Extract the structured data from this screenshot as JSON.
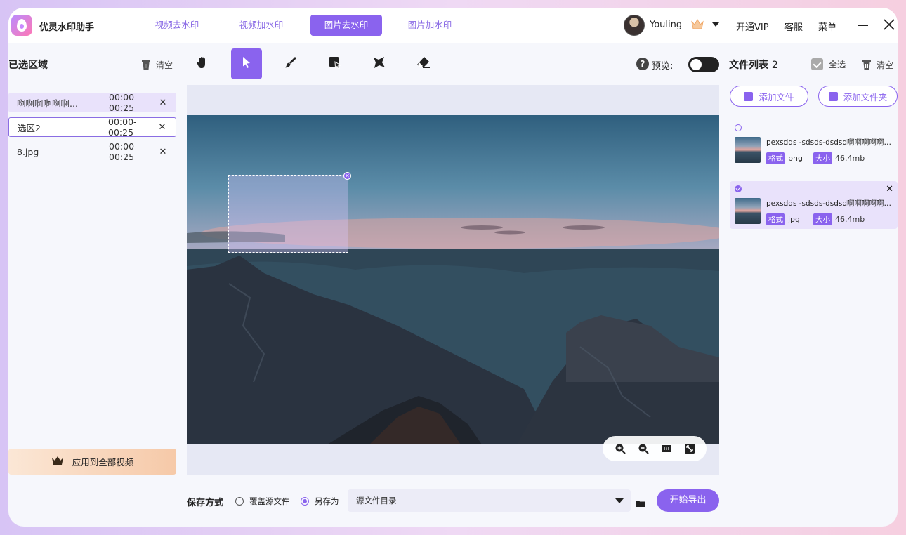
{
  "app": {
    "name": "优灵水印助手",
    "tabs": [
      {
        "label": "视频去水印",
        "active": false
      },
      {
        "label": "视频加水印",
        "active": false
      },
      {
        "label": "图片去水印",
        "active": true
      },
      {
        "label": "图片加水印",
        "active": false
      }
    ],
    "user": "Youling",
    "vip_label": "开通VIP",
    "service_label": "客服",
    "menu_label": "菜单"
  },
  "left_panel": {
    "title": "已选区域",
    "clear_label": "清空",
    "regions": [
      {
        "name": "啊啊啊啊啊啊...",
        "time": "00:00-00:25",
        "state": "hover"
      },
      {
        "name": "选区2",
        "time": "00:00-00:25",
        "state": "selected"
      },
      {
        "name": "8.jpg",
        "time": "00:00-00:25",
        "state": "normal"
      }
    ],
    "close_glyph": "✕",
    "apply_label": "应用到全部视频"
  },
  "toolbar": {
    "tools": [
      "hand-icon",
      "pointer-icon",
      "brush-icon",
      "rect-select-icon",
      "lasso-icon",
      "eraser-icon"
    ],
    "active_tool": "pointer-icon",
    "help_glyph": "?",
    "preview_label": "预览:",
    "preview_on": false
  },
  "bottom": {
    "save_label": "保存方式",
    "option_overwrite": "覆盖源文件",
    "option_saveas": "另存为",
    "selected_option": "另存为",
    "directory": "源文件目录",
    "export_label": "开始导出"
  },
  "right_panel": {
    "title": "文件列表",
    "count": "2",
    "select_all_label": "全选",
    "clear_label": "清空",
    "add_file_label": "添加文件",
    "add_folder_label": "添加文件夹",
    "format_tag": "格式",
    "size_tag": "大小",
    "files": [
      {
        "name": "pexsdds -sdsds-dsdsd啊啊啊啊啊啊啊啊",
        "format": "png",
        "size": "46.4mb",
        "selected": false
      },
      {
        "name": "pexsdds -sdsds-dsdsd啊啊啊啊啊啊啊啊",
        "format": "jpg",
        "size": "46.4mb",
        "selected": true
      }
    ]
  },
  "colors": {
    "accent": "#8a63ee",
    "accent_light": "#e9e2fb"
  }
}
